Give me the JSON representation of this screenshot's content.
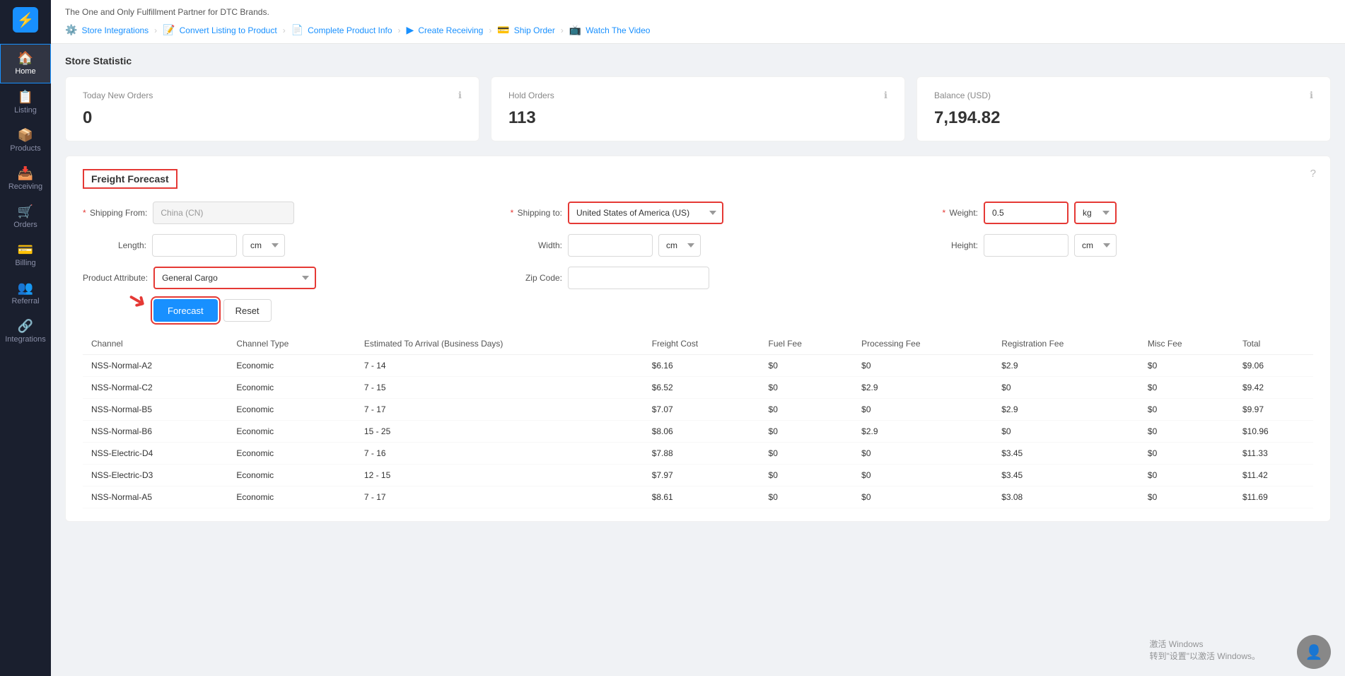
{
  "app": {
    "logo": "⚡",
    "tagline": "The One and Only Fulfillment Partner for DTC Brands."
  },
  "sidebar": {
    "items": [
      {
        "id": "home",
        "icon": "🏠",
        "label": "Home",
        "active": true
      },
      {
        "id": "listing",
        "icon": "📋",
        "label": "Listing",
        "active": false
      },
      {
        "id": "products",
        "icon": "📦",
        "label": "Products",
        "active": false
      },
      {
        "id": "receiving",
        "icon": "📥",
        "label": "Receiving",
        "active": false
      },
      {
        "id": "orders",
        "icon": "🛒",
        "label": "Orders",
        "active": false
      },
      {
        "id": "billing",
        "icon": "💳",
        "label": "Billing",
        "active": false
      },
      {
        "id": "referral",
        "icon": "👥",
        "label": "Referral",
        "active": false
      },
      {
        "id": "integrations",
        "icon": "🔗",
        "label": "Integrations",
        "active": false
      }
    ]
  },
  "steps": [
    {
      "id": "store-integrations",
      "icon": "⚙️",
      "label": "Store Integrations"
    },
    {
      "id": "convert-listing",
      "icon": "📝",
      "label": "Convert Listing to Product"
    },
    {
      "id": "complete-product-info",
      "icon": "📄",
      "label": "Complete Product Info"
    },
    {
      "id": "create-receiving",
      "icon": "▶",
      "label": "Create Receiving"
    },
    {
      "id": "ship-order",
      "icon": "💳",
      "label": "Ship Order"
    },
    {
      "id": "watch-video",
      "icon": "📺",
      "label": "Watch The Video"
    }
  ],
  "stats": {
    "section_title": "Store Statistic",
    "cards": [
      {
        "id": "today-orders",
        "label": "Today New Orders",
        "value": "0"
      },
      {
        "id": "hold-orders",
        "label": "Hold Orders",
        "value": "113"
      },
      {
        "id": "balance",
        "label": "Balance (USD)",
        "value": "7,194.82"
      }
    ]
  },
  "freight": {
    "title": "Freight Forecast",
    "help_icon": "?",
    "shipping_from_label": "Shipping From:",
    "shipping_from_value": "China (CN)",
    "shipping_to_label": "Shipping to:",
    "shipping_to_value": "United States of America (US)",
    "weight_label": "Weight:",
    "weight_value": "0.5",
    "weight_unit": "kg",
    "length_label": "Length:",
    "length_unit": "cm",
    "width_label": "Width:",
    "width_unit": "cm",
    "height_label": "Height:",
    "height_unit": "cm",
    "zip_label": "Zip Code:",
    "attr_label": "Product Attribute:",
    "attr_value": "General Cargo",
    "forecast_btn": "Forecast",
    "reset_btn": "Reset",
    "table": {
      "columns": [
        "Channel",
        "Channel Type",
        "Estimated To Arrival (Business Days)",
        "Freight Cost",
        "Fuel Fee",
        "Processing Fee",
        "Registration Fee",
        "Misc Fee",
        "Total"
      ],
      "rows": [
        {
          "channel": "NSS-Normal-A2",
          "type": "Economic",
          "eta": "7 - 14",
          "freight": "$6.16",
          "fuel": "$0",
          "processing": "$0",
          "registration": "$2.9",
          "misc": "$0",
          "total": "$9.06"
        },
        {
          "channel": "NSS-Normal-C2",
          "type": "Economic",
          "eta": "7 - 15",
          "freight": "$6.52",
          "fuel": "$0",
          "processing": "$2.9",
          "registration": "$0",
          "misc": "$0",
          "total": "$9.42"
        },
        {
          "channel": "NSS-Normal-B5",
          "type": "Economic",
          "eta": "7 - 17",
          "freight": "$7.07",
          "fuel": "$0",
          "processing": "$0",
          "registration": "$2.9",
          "misc": "$0",
          "total": "$9.97"
        },
        {
          "channel": "NSS-Normal-B6",
          "type": "Economic",
          "eta": "15 - 25",
          "freight": "$8.06",
          "fuel": "$0",
          "processing": "$2.9",
          "registration": "$0",
          "misc": "$0",
          "total": "$10.96"
        },
        {
          "channel": "NSS-Electric-D4",
          "type": "Economic",
          "eta": "7 - 16",
          "freight": "$7.88",
          "fuel": "$0",
          "processing": "$0",
          "registration": "$3.45",
          "misc": "$0",
          "total": "$11.33"
        },
        {
          "channel": "NSS-Electric-D3",
          "type": "Economic",
          "eta": "12 - 15",
          "freight": "$7.97",
          "fuel": "$0",
          "processing": "$0",
          "registration": "$3.45",
          "misc": "$0",
          "total": "$11.42"
        },
        {
          "channel": "NSS-Normal-A5",
          "type": "Economic",
          "eta": "7 - 17",
          "freight": "$8.61",
          "fuel": "$0",
          "processing": "$0",
          "registration": "$3.08",
          "misc": "$0",
          "total": "$11.69"
        }
      ]
    }
  },
  "watermark": {
    "line1": "激活 Windows",
    "line2": "转到\"设置\"以激活 Windows。"
  }
}
